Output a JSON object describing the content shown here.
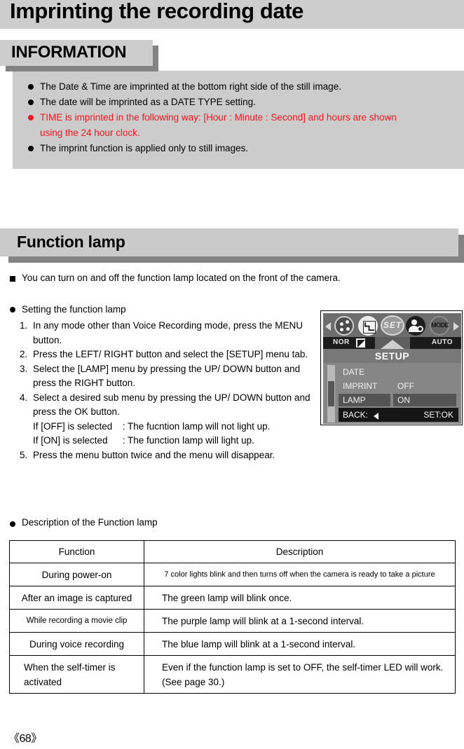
{
  "page": {
    "title": "Imprinting the recording date",
    "page_number": "《68》"
  },
  "information_box": {
    "tab_label": "INFORMATION",
    "bullets": [
      {
        "text": "The Date & Time are imprinted at the bottom right side of the still image.",
        "color": "#000000"
      },
      {
        "text": "The date will be imprinted as a DATE TYPE setting.",
        "color": "#000000"
      },
      {
        "text": "TIME is imprinted in the following way: [Hour : Minute : Second] and hours are shown",
        "text_cont": "using the 24 hour clock.",
        "color": "#ee1b24"
      },
      {
        "text": "The imprint function is applied only to still images.",
        "color": "#000000"
      }
    ]
  },
  "section": {
    "heading": "Function lamp",
    "intro": "You can turn on and off the function lamp located on the front of the camera.",
    "setting_heading": "Setting the function lamp",
    "steps": [
      {
        "num": "1.",
        "text": "In any mode other than Voice Recording mode, press the MENU button."
      },
      {
        "num": "2.",
        "text": "Press the LEFT/ RIGHT button and select the [SETUP] menu tab."
      },
      {
        "num": "3.",
        "text": "Select the [LAMP] menu by pressing the UP/ DOWN button and press the RIGHT button."
      },
      {
        "num": "4.",
        "text": "Select a desired sub menu by pressing the UP/ DOWN button and press the OK button."
      },
      {
        "num": "5.",
        "text": "Press the menu button twice and the menu will disappear."
      }
    ],
    "sub_notes": [
      {
        "label": "If [OFF] is selected",
        "value": ": The fucntion lamp will not light up."
      },
      {
        "label": "If [ON] is selected",
        "value": ": The function lamp will light up."
      }
    ]
  },
  "lcd": {
    "icons": [
      "palette-icon",
      "quality-curve-icon",
      "set-icon",
      "person-setup-icon",
      "mode-icon"
    ],
    "set_label": "SET",
    "mode_label": "MODE",
    "status": {
      "quality": "NOR",
      "flash": "flash-off-icon",
      "mode": "AUTO"
    },
    "menu_title": "SETUP",
    "menu_rows": [
      {
        "label": "DATE",
        "value": "",
        "selected": false
      },
      {
        "label": "IMPRINT",
        "value": "OFF",
        "selected": false
      },
      {
        "label": "LAMP",
        "value": "ON",
        "selected": true
      }
    ],
    "footer": {
      "back": "BACK:",
      "set": "SET:OK"
    }
  },
  "description": {
    "heading": "Description of the Function lamp",
    "columns": [
      "Function",
      "Description"
    ],
    "rows": [
      {
        "function": "During power-on",
        "description": "7 color lights blink and then turns off when the camera is ready to take a picture"
      },
      {
        "function": "After an image is captured",
        "description": "The green lamp will blink once."
      },
      {
        "function": "While recording a movie clip",
        "description": "The purple lamp will blink at a 1-second interval."
      },
      {
        "function": "During voice recording",
        "description": "The blue lamp will blink at a 1-second interval."
      },
      {
        "function": "When the self-timer is activated",
        "description": "Even if the function lamp is set to OFF, the self-timer LED will work. (See page 30.)"
      }
    ]
  }
}
